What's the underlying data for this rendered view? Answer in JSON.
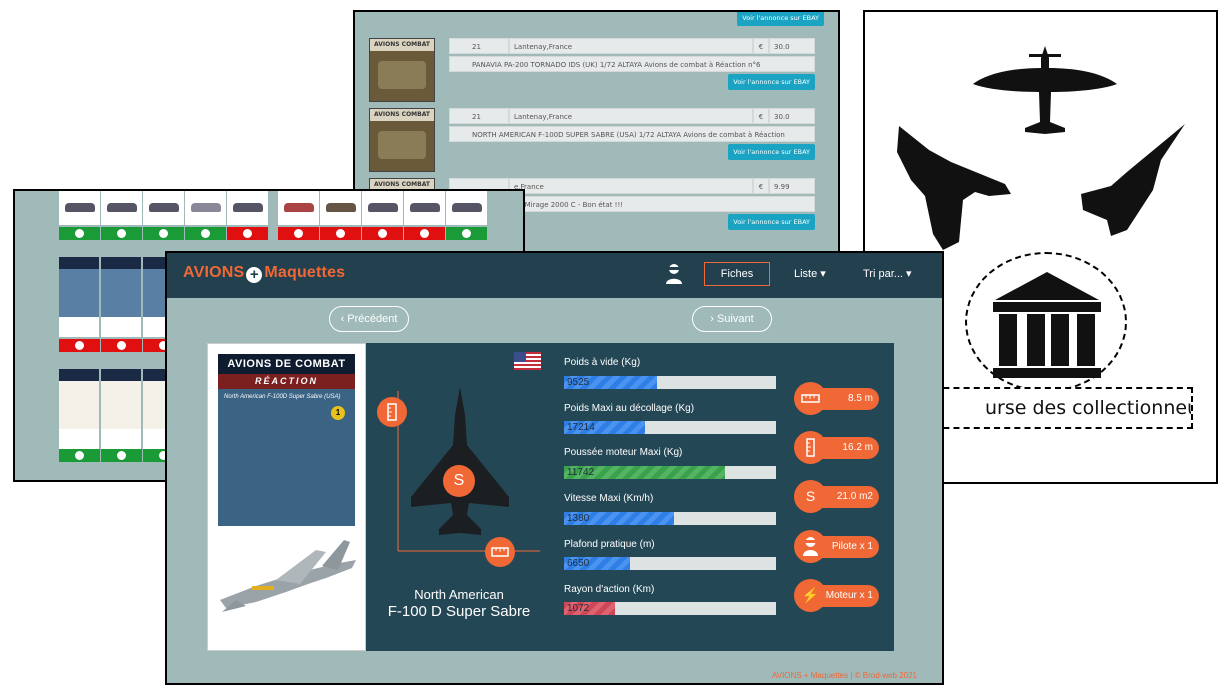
{
  "listing": {
    "rows": [
      {
        "qty": "21",
        "location": "Lantenay,France",
        "currency": "€",
        "price": "30.0",
        "title": "PANAVIA PA-200 TORNADO IDS (UK) 1/72 ALTAYA Avions de combat à Réaction n°6",
        "button": "Voir l'annonce sur EBAY"
      },
      {
        "qty": "21",
        "location": "Lantenay,France",
        "currency": "€",
        "price": "30.0",
        "title": "NORTH AMERICAN F-100D SUPER SABRE (USA) 1/72 ALTAYA Avions de combat à Réaction",
        "button": "Voir l'annonce sur EBAY"
      },
      {
        "qty": "",
        "location": "e,France",
        "currency": "€",
        "price": "9.99",
        "title": "t à réaction Le Mirage 2000 C - Bon état !!!",
        "button": "Voir l'annonce sur EBAY"
      }
    ],
    "top_button": "Voir l'annonce sur EBAY"
  },
  "poster": {
    "label": "urse des collectionneurs",
    "icons": [
      "spitfire-silhouette-icon",
      "rafale-silhouette-icon",
      "mirage-silhouette-icon",
      "museum-icon"
    ]
  },
  "grid": {
    "row1_status": [
      "ok",
      "ok",
      "ok",
      "ok",
      "no",
      "no",
      "no",
      "no",
      "no",
      "ok"
    ],
    "row2_status": [
      "no",
      "no",
      "no"
    ],
    "row3_status": [
      "ok",
      "ok",
      "ok"
    ],
    "book_header": "AVIONS DE COMBAT",
    "book_sub": "RÉACTION"
  },
  "main": {
    "brand_left": "AVIONS",
    "brand_plus": "+",
    "brand_right": "Maquettes",
    "nav": {
      "fiches": "Fiches",
      "liste": "Liste ▾",
      "tri": "Tri par... ▾"
    },
    "prev": "‹ Précédent",
    "next": "› Suivant",
    "cover": {
      "title": "AVIONS DE COMBAT",
      "subtitle": "RÉACTION",
      "model": "North American F-100D Super Sabre (USA)",
      "number": "1"
    },
    "flag": "us-flag-icon",
    "silhouette_badge": "S",
    "name_line1": "North American",
    "name_line2": "F-100 D Super Sabre",
    "stats": [
      {
        "label": "Poids à vide (Kg)",
        "value": "9525",
        "fraction": 0.44,
        "color": "blue"
      },
      {
        "label": "Poids Maxi au décollage (Kg)",
        "value": "17214",
        "fraction": 0.38,
        "color": "blue"
      },
      {
        "label": "Poussée moteur Maxi (Kg)",
        "value": "11742",
        "fraction": 0.76,
        "color": "green"
      },
      {
        "label": "Vitesse Maxi (Km/h)",
        "value": "1380",
        "fraction": 0.52,
        "color": "blue"
      },
      {
        "label": "Plafond pratique (m)",
        "value": "6650",
        "fraction": 0.31,
        "color": "blue"
      },
      {
        "label": "Rayon d'action (Km)",
        "value": "1072",
        "fraction": 0.24,
        "color": "red"
      }
    ],
    "badges": [
      {
        "icon": "ruler-horizontal-icon",
        "text": "8.5 m"
      },
      {
        "icon": "ruler-vertical-icon",
        "text": "16.2 m"
      },
      {
        "icon": "surface-icon",
        "glyph": "S",
        "text": "21.0 m2"
      },
      {
        "icon": "pilot-icon",
        "text": "Pilote x 1"
      },
      {
        "icon": "lightning-icon",
        "glyph": "⚡",
        "text": "Moteur x 1"
      }
    ],
    "footer": "AVIONS + Maquettes | © Brod-web 2021",
    "accent": "#f06836",
    "navbar_color": "#23404f"
  }
}
